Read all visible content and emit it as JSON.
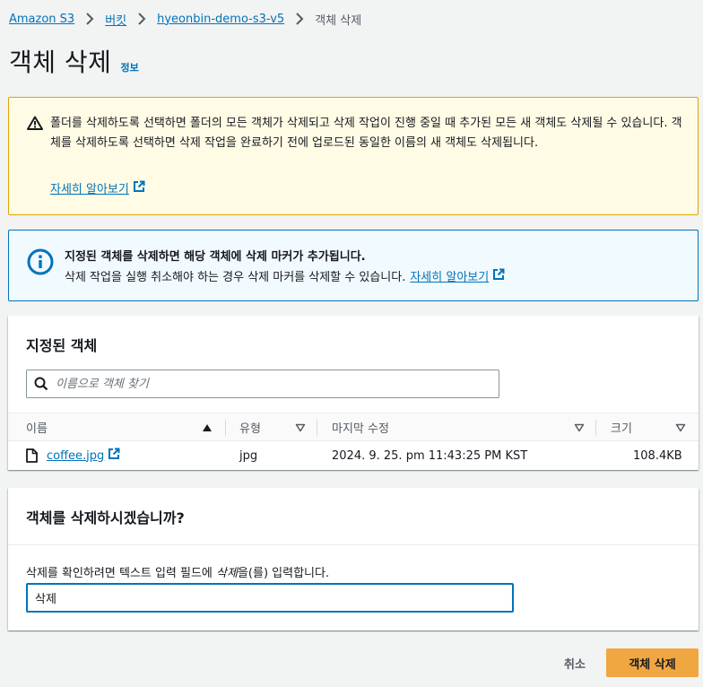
{
  "breadcrumb": {
    "items": [
      "Amazon S3",
      "버킷",
      "hyeonbin-demo-s3-v5",
      "객체 삭제"
    ]
  },
  "page": {
    "title": "객체 삭제",
    "info_label": "정보"
  },
  "warning": {
    "text": "폴더를 삭제하도록 선택하면 폴더의 모든 객체가 삭제되고 삭제 작업이 진행 중일 때 추가된 모든 새 객체도 삭제될 수 있습니다. 객체를 삭제하도록 선택하면 삭제 작업을 완료하기 전에 업로드된 동일한 이름의 새 객체도 삭제됩니다.",
    "learn_more": "자세히 알아보기",
    "color": "#e0a600"
  },
  "info": {
    "heading": "지정된 객체를 삭제하면 해당 객체에 삭제 마커가 추가됩니다.",
    "body": "삭제 작업을 실행 취소해야 하는 경우 삭제 마커를 삭제할 수 있습니다.",
    "learn_more": "자세히 알아보기",
    "color": "#0073bb"
  },
  "objects_panel": {
    "title": "지정된 객체",
    "search_placeholder": "이름으로 객체 찾기",
    "columns": [
      "이름",
      "유형",
      "마지막 수정",
      "크기"
    ],
    "rows": [
      {
        "name": "coffee.jpg",
        "type": "jpg",
        "last_modified": "2024. 9. 25. pm 11:43:25 PM KST",
        "size": "108.4KB"
      }
    ]
  },
  "confirm_panel": {
    "title": "객체를 삭제하시겠습니까?",
    "label_prefix": "삭제를 확인하려면 텍스트 입력 필드에 ",
    "label_keyword": "삭제",
    "label_suffix": "을(를) 입력합니다.",
    "input_value": "삭제"
  },
  "actions": {
    "cancel_label": "취소",
    "delete_label": "객체 삭제",
    "primary_color": "#ec7211"
  }
}
